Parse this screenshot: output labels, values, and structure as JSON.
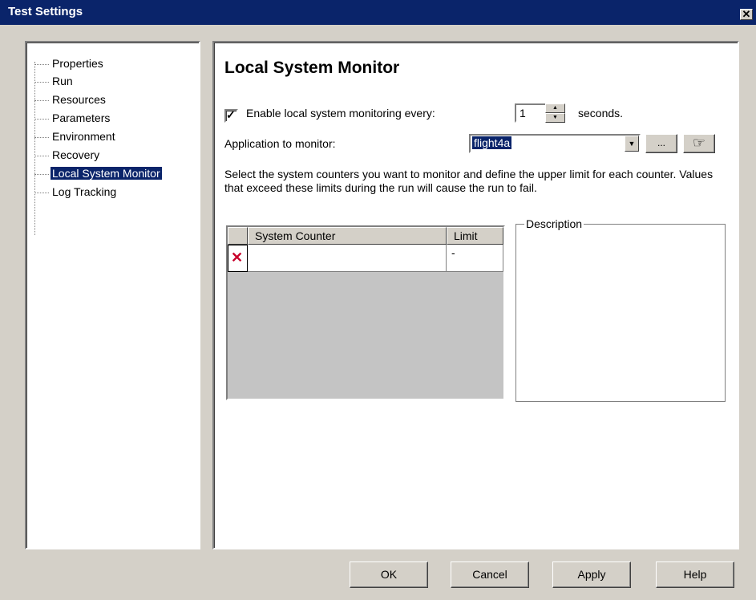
{
  "window": {
    "title": "Test Settings",
    "close_glyph": "✕"
  },
  "tree": {
    "items": [
      {
        "label": "Properties",
        "selected": false
      },
      {
        "label": "Run",
        "selected": false
      },
      {
        "label": "Resources",
        "selected": false
      },
      {
        "label": "Parameters",
        "selected": false
      },
      {
        "label": "Environment",
        "selected": false
      },
      {
        "label": "Recovery",
        "selected": false
      },
      {
        "label": "Local System Monitor",
        "selected": true
      },
      {
        "label": "Log Tracking",
        "selected": false
      }
    ]
  },
  "panel": {
    "title": "Local System Monitor",
    "enable_checkbox": {
      "checked": true,
      "label": "Enable local system monitoring every:"
    },
    "interval": {
      "value": "1",
      "unit_label": "seconds."
    },
    "application": {
      "label": "Application to monitor:",
      "value": "flight4a",
      "browse_label": "..."
    },
    "instructions": "Select the system counters you want to monitor and define the upper limit for each counter. Values that exceed these limits during the run will cause the run to fail.",
    "grid": {
      "columns": [
        "System Counter",
        "Limit"
      ],
      "rows": [
        {
          "counter": "",
          "limit": "-"
        }
      ]
    },
    "description": {
      "legend": "Description",
      "text": ""
    }
  },
  "buttons": {
    "ok": "OK",
    "cancel": "Cancel",
    "apply": "Apply",
    "help": "Help"
  },
  "icons": {
    "close": "close-icon",
    "spin_up": "spin-up-icon",
    "spin_down": "spin-down-icon",
    "dropdown": "dropdown-arrow-icon",
    "hand": "pointing-hand-icon",
    "delete_row": "delete-row-icon"
  },
  "colors": {
    "titlebar": "#0a246a",
    "dialog": "#d4d0c8",
    "selection": "#0a246a",
    "delete_x": "#c8002a"
  }
}
